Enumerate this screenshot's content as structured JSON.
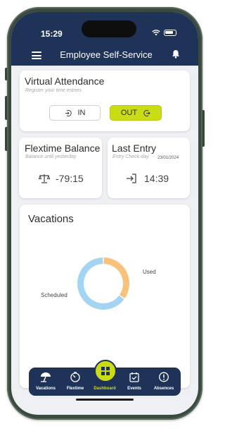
{
  "status_bar": {
    "time": "15:29"
  },
  "header": {
    "title": "Employee Self-Service",
    "menu_icon": "hamburger-icon",
    "notify_icon": "bell-icon"
  },
  "virtual_attendance": {
    "title": "Virtual Attendance",
    "subtitle": "Register your time entries",
    "in_label": "IN",
    "out_label": "OUT",
    "out_color": "#cadd14"
  },
  "flextime_balance": {
    "title": "Flextime Balance",
    "subtitle": "Balance until yesterday",
    "value": "-79:15",
    "icon": "balance-scale-icon"
  },
  "last_entry": {
    "title": "Last Entry",
    "subtitle": "Entry Check-day",
    "date": "23/01/2024",
    "value": "14:39",
    "icon": "login-arrow-icon"
  },
  "vacations": {
    "title": "Vacations",
    "chart_data": {
      "type": "pie",
      "categories": [
        "Used",
        "Scheduled"
      ],
      "values": [
        35,
        65
      ],
      "colors": [
        "#f7c27a",
        "#a3d4f1"
      ]
    }
  },
  "bottom_nav": {
    "items": [
      {
        "label": "Vacations",
        "icon": "beach-umbrella-icon"
      },
      {
        "label": "Flextime",
        "icon": "timer-icon"
      },
      {
        "label": "Dashboard",
        "icon": "dashboard-grid-icon",
        "active": true
      },
      {
        "label": "Events",
        "icon": "calendar-check-icon"
      },
      {
        "label": "Absences",
        "icon": "alert-circle-icon"
      }
    ],
    "active_color": "#cadd14",
    "bar_color": "#1f3258"
  }
}
